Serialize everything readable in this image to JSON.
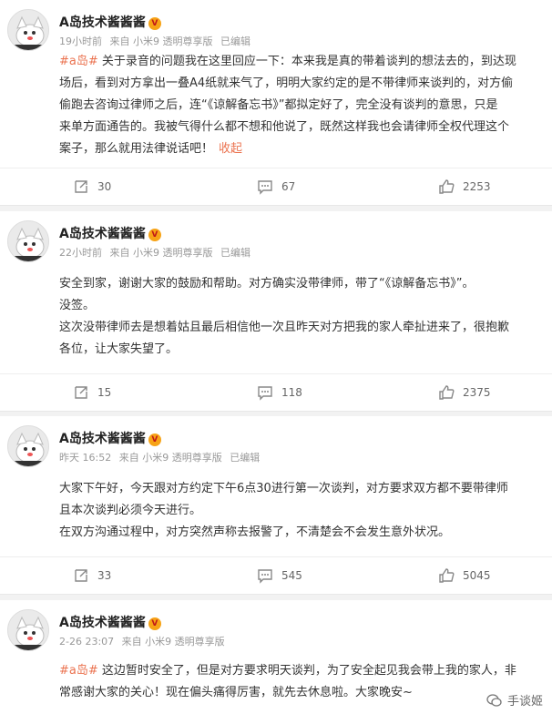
{
  "posts": [
    {
      "author": "A岛技术酱酱酱",
      "time": "19小时前",
      "device": "来自 小米9 透明尊享版",
      "edited": "已编辑",
      "tag": "#a岛#",
      "lines": [
        "关于录音的问题我在这里回应一下：本来我是真的带着谈判的想法去的，到达现",
        "场后，看到对方拿出一叠A4纸就来气了，明明大家约定的是不带律师来谈判的，对方偷",
        "偷跑去咨询过律师之后，连“《谅解备忘书》”都拟定好了，完全没有谈判的意思，只是",
        "来单方面通告的。我被气得什么都不想和他说了，既然这样我也会请律师全权代理这个",
        "案子，那么就用法律说话吧！"
      ],
      "collapse": "收起",
      "reposts": "30",
      "comments": "67",
      "likes": "2253"
    },
    {
      "author": "A岛技术酱酱酱",
      "time": "22小时前",
      "device": "来自 小米9 透明尊享版",
      "edited": "已编辑",
      "lines": [
        "安全到家，谢谢大家的鼓励和帮助。对方确实没带律师，带了“《谅解备忘书》”。",
        "没签。",
        "这次没带律师去是想着姑且最后相信他一次且昨天对方把我的家人牵扯进来了，很抱歉",
        "各位，让大家失望了。"
      ],
      "reposts": "15",
      "comments": "118",
      "likes": "2375"
    },
    {
      "author": "A岛技术酱酱酱",
      "time": "昨天 16:52",
      "device": "来自 小米9 透明尊享版",
      "edited": "已编辑",
      "lines": [
        "大家下午好，今天跟对方约定下午6点30进行第一次谈判，对方要求双方都不要带律师",
        "且本次谈判必须今天进行。",
        "在双方沟通过程中，对方突然声称去报警了，不清楚会不会发生意外状况。"
      ],
      "reposts": "33",
      "comments": "545",
      "likes": "5045"
    },
    {
      "author": "A岛技术酱酱酱",
      "time": "2-26 23:07",
      "device": "来自 小米9 透明尊享版",
      "tag": "#a岛#",
      "lines": [
        "这边暂时安全了，但是对方要求明天谈判，为了安全起见我会带上我的家人，非",
        "常感谢大家的关心！现在偏头痛得厉害，就先去休息啦。大家晚安~"
      ]
    }
  ],
  "watermark": "手谈姬",
  "icons": {
    "repost": "repost-icon",
    "comment": "comment-icon",
    "like": "thumbs-up-icon",
    "badge": "verified-badge-icon"
  },
  "colors": {
    "accent": "#eb7350",
    "badge": "#f7a316"
  }
}
